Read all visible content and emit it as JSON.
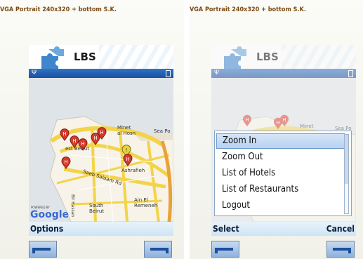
{
  "caption": "VGA  Portrait  240x320  + bottom S.K.",
  "app": {
    "title": "LBS"
  },
  "left_screen": {
    "softkey_left": "Options",
    "map_labels": {
      "minet_al_hosn": "Minet\nal Hosn",
      "west_beirut": "est Beirut",
      "ashrafieh": "Ashrafieh",
      "sea_port": "Sea Po",
      "saeb_salaam": "Saeb Salaam Rd",
      "south_beirut": "South\nBeirut",
      "ain_el_remeneh": "Ain El\nRemeneh",
      "bir_hassan": "Bir Hassan"
    },
    "powered_by": "POWERED BY",
    "google": "Google"
  },
  "right_screen": {
    "softkey_left": "Select",
    "softkey_right": "Cancel",
    "map_labels": {
      "minet": "Minet",
      "sea_port": "Sea Po"
    },
    "menu": {
      "items": [
        {
          "label": "Zoom In",
          "selected": true
        },
        {
          "label": "Zoom Out",
          "selected": false
        },
        {
          "label": "List of Hotels",
          "selected": false
        },
        {
          "label": "List of Restaurants",
          "selected": false
        },
        {
          "label": "Logout",
          "selected": false
        }
      ]
    }
  },
  "icons": {
    "app_icon": "puzzle-piece-icon",
    "signal": "antenna-signal-icon",
    "battery": "battery-icon",
    "hotel_pin": "hotel-pin-icon",
    "info_pin": "info-pin-icon"
  },
  "colors": {
    "statusbar": "#2f73c6",
    "softkey_bar": "#cfe4f4",
    "hotel_pin": "#d83a2e",
    "info_pin": "#e7d23a",
    "road_yellow": "#f3d34a",
    "land": "#f7f3e8",
    "sea": "#dfe4e8"
  }
}
